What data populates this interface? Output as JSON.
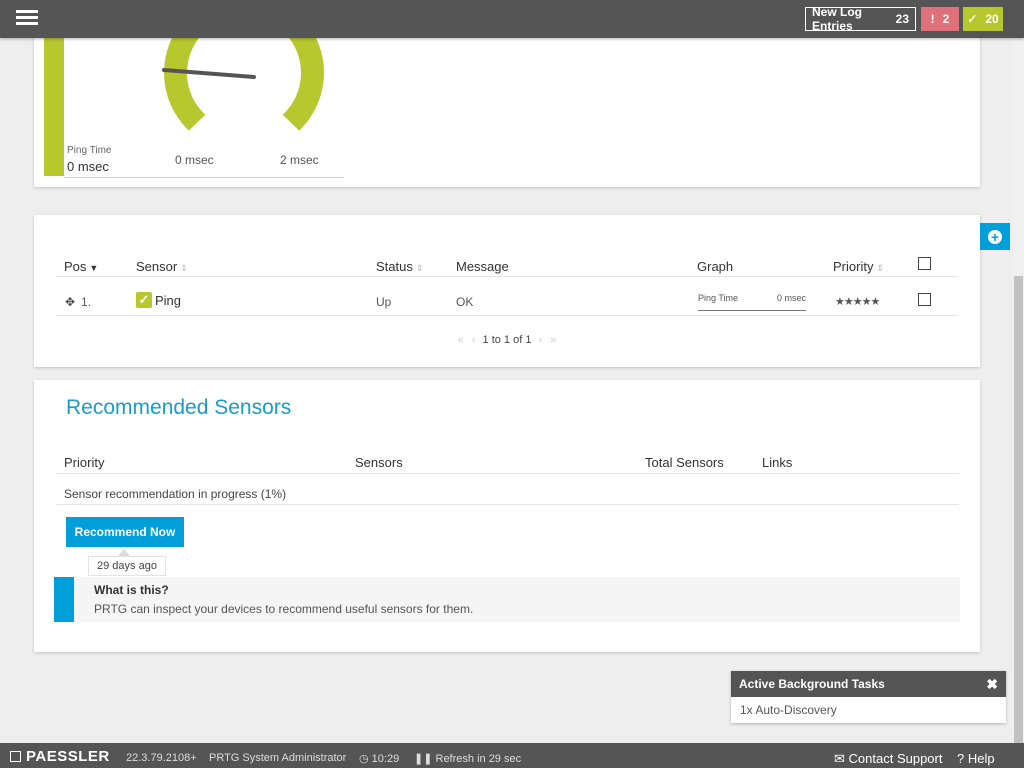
{
  "topbar": {
    "log_label": "New Log Entries",
    "log_count": "23",
    "alarm_count": "2",
    "ok_count": "20"
  },
  "gauge": {
    "label": "Ping Time",
    "value": "0 msec",
    "min": "0 msec",
    "max": "2 msec"
  },
  "sensor_table": {
    "headers": {
      "pos": "Pos",
      "sensor": "Sensor",
      "status": "Status",
      "message": "Message",
      "graph": "Graph",
      "priority": "Priority"
    },
    "rows": [
      {
        "pos": "1.",
        "sensor": "Ping",
        "status": "Up",
        "message": "OK",
        "graph_label": "Ping Time",
        "graph_value": "0 msec",
        "priority": "★★★★★"
      }
    ],
    "pager": "1 to 1 of 1"
  },
  "recommended": {
    "title": "Recommended Sensors",
    "headers": {
      "priority": "Priority",
      "sensors": "Sensors",
      "total": "Total Sensors",
      "links": "Links"
    },
    "progress_text": "Sensor recommendation in progress (1%)",
    "button_label": "Recommend Now",
    "tooltip": "29 days ago",
    "info_title": "What is this?",
    "info_text": "PRTG can inspect your devices to recommend useful sensors for them."
  },
  "tasks": {
    "title": "Active Background Tasks",
    "item": "1x Auto-Discovery"
  },
  "footer": {
    "brand": "PAESSLER",
    "version": "22.3.79.2108+",
    "user": "PRTG System Administrator",
    "time": "10:29",
    "refresh": "Refresh in 29 sec",
    "contact": "Contact Support",
    "help": "Help"
  },
  "colors": {
    "accent": "#009fda",
    "ok": "#b7c72e",
    "alarm": "#e0707a",
    "bar": "#555555"
  }
}
